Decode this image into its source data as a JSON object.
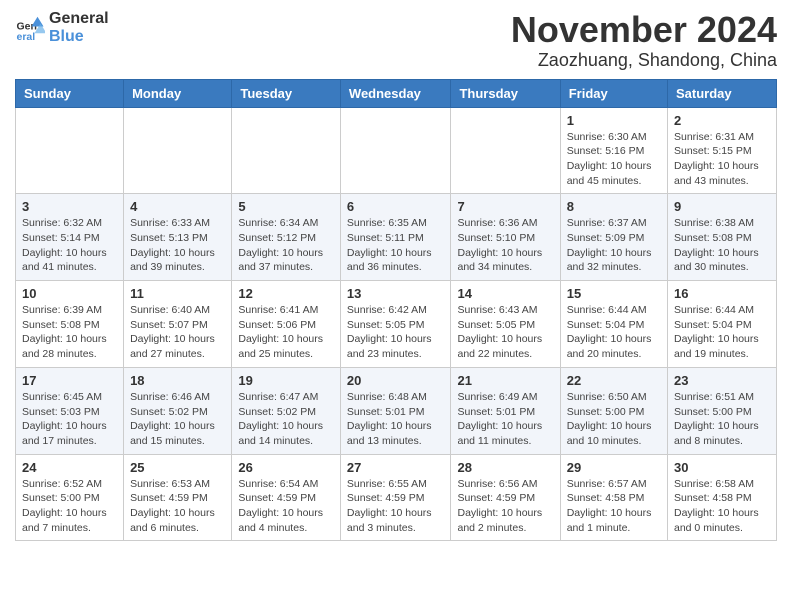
{
  "header": {
    "logo_general": "General",
    "logo_blue": "Blue",
    "month": "November 2024",
    "location": "Zaozhuang, Shandong, China"
  },
  "weekdays": [
    "Sunday",
    "Monday",
    "Tuesday",
    "Wednesday",
    "Thursday",
    "Friday",
    "Saturday"
  ],
  "weeks": [
    [
      {
        "day": "",
        "info": ""
      },
      {
        "day": "",
        "info": ""
      },
      {
        "day": "",
        "info": ""
      },
      {
        "day": "",
        "info": ""
      },
      {
        "day": "",
        "info": ""
      },
      {
        "day": "1",
        "info": "Sunrise: 6:30 AM\nSunset: 5:16 PM\nDaylight: 10 hours\nand 45 minutes."
      },
      {
        "day": "2",
        "info": "Sunrise: 6:31 AM\nSunset: 5:15 PM\nDaylight: 10 hours\nand 43 minutes."
      }
    ],
    [
      {
        "day": "3",
        "info": "Sunrise: 6:32 AM\nSunset: 5:14 PM\nDaylight: 10 hours\nand 41 minutes."
      },
      {
        "day": "4",
        "info": "Sunrise: 6:33 AM\nSunset: 5:13 PM\nDaylight: 10 hours\nand 39 minutes."
      },
      {
        "day": "5",
        "info": "Sunrise: 6:34 AM\nSunset: 5:12 PM\nDaylight: 10 hours\nand 37 minutes."
      },
      {
        "day": "6",
        "info": "Sunrise: 6:35 AM\nSunset: 5:11 PM\nDaylight: 10 hours\nand 36 minutes."
      },
      {
        "day": "7",
        "info": "Sunrise: 6:36 AM\nSunset: 5:10 PM\nDaylight: 10 hours\nand 34 minutes."
      },
      {
        "day": "8",
        "info": "Sunrise: 6:37 AM\nSunset: 5:09 PM\nDaylight: 10 hours\nand 32 minutes."
      },
      {
        "day": "9",
        "info": "Sunrise: 6:38 AM\nSunset: 5:08 PM\nDaylight: 10 hours\nand 30 minutes."
      }
    ],
    [
      {
        "day": "10",
        "info": "Sunrise: 6:39 AM\nSunset: 5:08 PM\nDaylight: 10 hours\nand 28 minutes."
      },
      {
        "day": "11",
        "info": "Sunrise: 6:40 AM\nSunset: 5:07 PM\nDaylight: 10 hours\nand 27 minutes."
      },
      {
        "day": "12",
        "info": "Sunrise: 6:41 AM\nSunset: 5:06 PM\nDaylight: 10 hours\nand 25 minutes."
      },
      {
        "day": "13",
        "info": "Sunrise: 6:42 AM\nSunset: 5:05 PM\nDaylight: 10 hours\nand 23 minutes."
      },
      {
        "day": "14",
        "info": "Sunrise: 6:43 AM\nSunset: 5:05 PM\nDaylight: 10 hours\nand 22 minutes."
      },
      {
        "day": "15",
        "info": "Sunrise: 6:44 AM\nSunset: 5:04 PM\nDaylight: 10 hours\nand 20 minutes."
      },
      {
        "day": "16",
        "info": "Sunrise: 6:44 AM\nSunset: 5:04 PM\nDaylight: 10 hours\nand 19 minutes."
      }
    ],
    [
      {
        "day": "17",
        "info": "Sunrise: 6:45 AM\nSunset: 5:03 PM\nDaylight: 10 hours\nand 17 minutes."
      },
      {
        "day": "18",
        "info": "Sunrise: 6:46 AM\nSunset: 5:02 PM\nDaylight: 10 hours\nand 15 minutes."
      },
      {
        "day": "19",
        "info": "Sunrise: 6:47 AM\nSunset: 5:02 PM\nDaylight: 10 hours\nand 14 minutes."
      },
      {
        "day": "20",
        "info": "Sunrise: 6:48 AM\nSunset: 5:01 PM\nDaylight: 10 hours\nand 13 minutes."
      },
      {
        "day": "21",
        "info": "Sunrise: 6:49 AM\nSunset: 5:01 PM\nDaylight: 10 hours\nand 11 minutes."
      },
      {
        "day": "22",
        "info": "Sunrise: 6:50 AM\nSunset: 5:00 PM\nDaylight: 10 hours\nand 10 minutes."
      },
      {
        "day": "23",
        "info": "Sunrise: 6:51 AM\nSunset: 5:00 PM\nDaylight: 10 hours\nand 8 minutes."
      }
    ],
    [
      {
        "day": "24",
        "info": "Sunrise: 6:52 AM\nSunset: 5:00 PM\nDaylight: 10 hours\nand 7 minutes."
      },
      {
        "day": "25",
        "info": "Sunrise: 6:53 AM\nSunset: 4:59 PM\nDaylight: 10 hours\nand 6 minutes."
      },
      {
        "day": "26",
        "info": "Sunrise: 6:54 AM\nSunset: 4:59 PM\nDaylight: 10 hours\nand 4 minutes."
      },
      {
        "day": "27",
        "info": "Sunrise: 6:55 AM\nSunset: 4:59 PM\nDaylight: 10 hours\nand 3 minutes."
      },
      {
        "day": "28",
        "info": "Sunrise: 6:56 AM\nSunset: 4:59 PM\nDaylight: 10 hours\nand 2 minutes."
      },
      {
        "day": "29",
        "info": "Sunrise: 6:57 AM\nSunset: 4:58 PM\nDaylight: 10 hours\nand 1 minute."
      },
      {
        "day": "30",
        "info": "Sunrise: 6:58 AM\nSunset: 4:58 PM\nDaylight: 10 hours\nand 0 minutes."
      }
    ]
  ]
}
